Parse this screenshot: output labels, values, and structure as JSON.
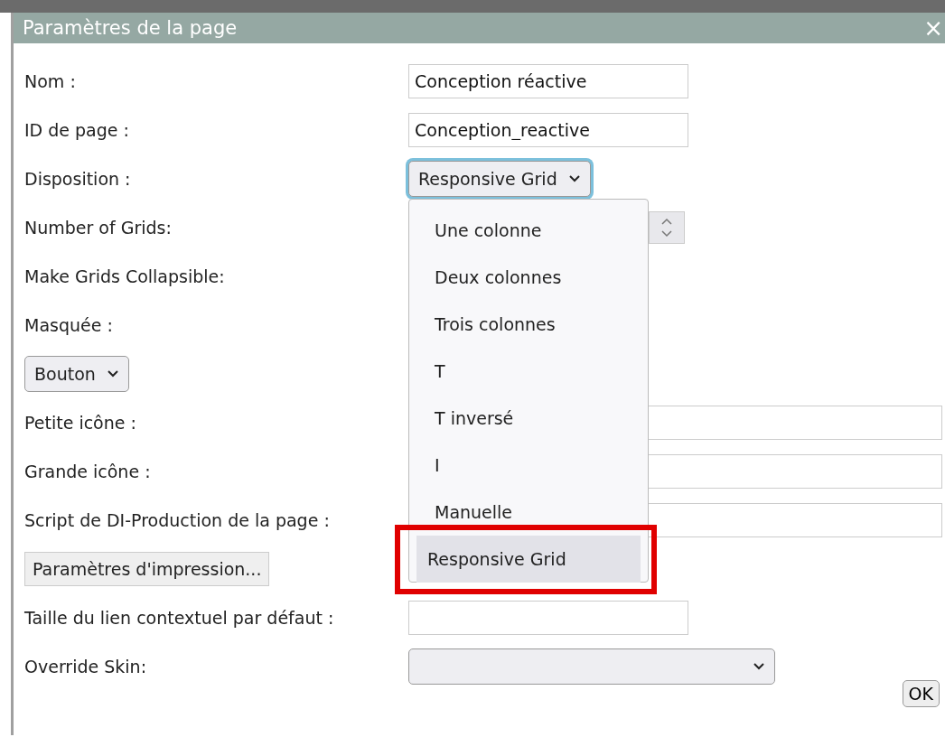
{
  "dialog": {
    "title": "Paramètres de la page",
    "close": "×"
  },
  "rows": [
    {
      "kind": "text",
      "label": "Nom :",
      "value": "Conception réactive"
    },
    {
      "kind": "text",
      "label": "ID de page :",
      "value": "Conception_reactive"
    },
    {
      "kind": "select",
      "label": "Disposition :",
      "value": "Responsive Grid",
      "focused": true
    },
    {
      "kind": "number",
      "label": "Number of Grids:"
    },
    {
      "kind": "label",
      "label": "Make Grids Collapsible:"
    },
    {
      "kind": "label",
      "label": "Masquée :"
    },
    {
      "kind": "small_select",
      "value": "Bouton"
    },
    {
      "kind": "wide_text",
      "label": "Petite icône :"
    },
    {
      "kind": "wide_text",
      "label": "Grande icône :"
    },
    {
      "kind": "wide_text",
      "label": "Script de DI-Production de la page :"
    },
    {
      "kind": "button",
      "value": "Paramètres d'impression..."
    },
    {
      "kind": "text",
      "label": "Taille du lien contextuel par défaut :"
    },
    {
      "kind": "wide_select",
      "label": "Override Skin:"
    }
  ],
  "dropdown": {
    "options": [
      {
        "label": "Une colonne",
        "selected": false
      },
      {
        "label": "Deux colonnes",
        "selected": false
      },
      {
        "label": "Trois colonnes",
        "selected": false
      },
      {
        "label": "T",
        "selected": false
      },
      {
        "label": "T inversé",
        "selected": false
      },
      {
        "label": "I",
        "selected": false
      },
      {
        "label": "Manuelle",
        "selected": false
      },
      {
        "label": "Responsive Grid",
        "selected": true
      }
    ]
  },
  "ok_button": "OK"
}
